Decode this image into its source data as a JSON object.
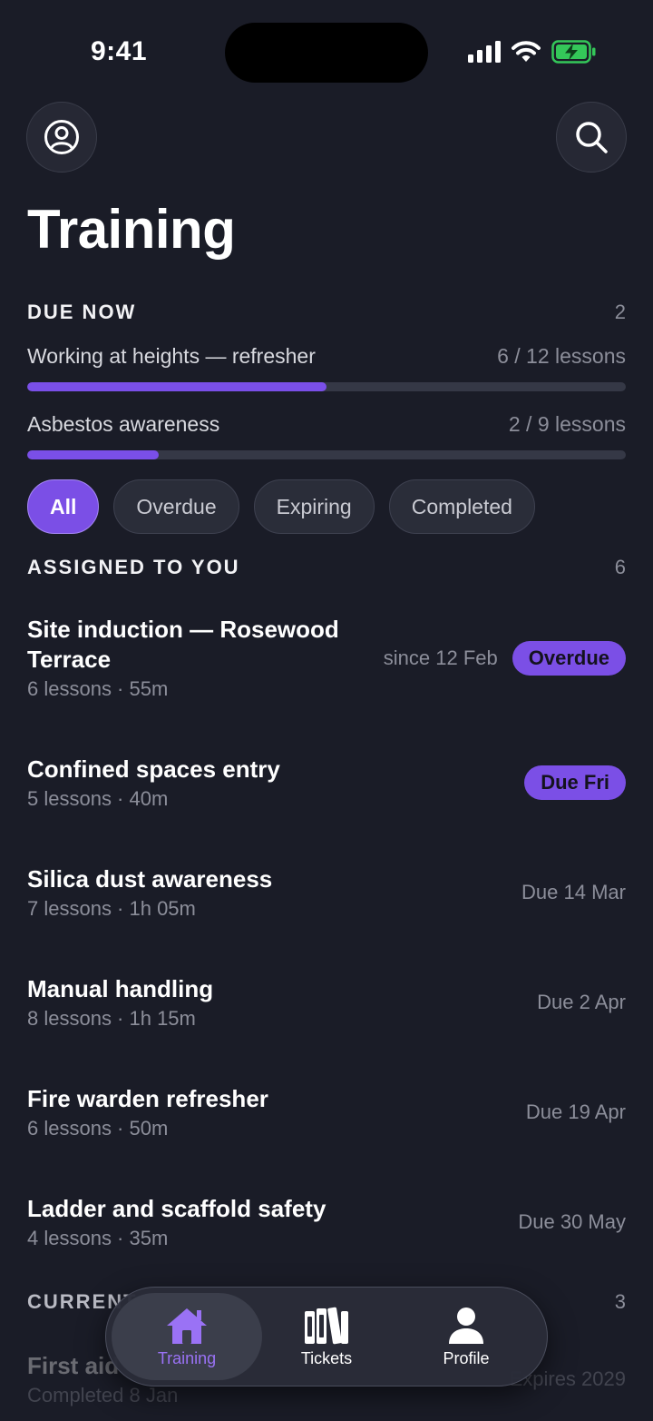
{
  "status_bar": {
    "time": "9:41"
  },
  "header": {
    "title": "Training"
  },
  "due_now": {
    "label": "DUE NOW",
    "count": "2",
    "items": [
      {
        "title": "Working at heights — refresher",
        "progress_text": "6 / 12 lessons",
        "progress": 0.5
      },
      {
        "title": "Asbestos awareness",
        "progress_text": "2 / 9 lessons",
        "progress": 0.22
      }
    ]
  },
  "filters": [
    {
      "label": "All",
      "active": true
    },
    {
      "label": "Overdue",
      "active": false
    },
    {
      "label": "Expiring",
      "active": false
    },
    {
      "label": "Completed",
      "active": false
    }
  ],
  "assigned": {
    "label": "ASSIGNED TO YOU",
    "count": "6",
    "items": [
      {
        "title_line1": "Site induction — Rosewood",
        "title_line2": "Terrace",
        "meta": "6 lessons · 55m",
        "date": "since 12 Feb",
        "badge": "Overdue"
      },
      {
        "title": "Confined spaces entry",
        "meta": "5 lessons · 40m",
        "badge": "Due Fri"
      },
      {
        "title": "Silica dust awareness",
        "meta": "7 lessons · 1h 05m",
        "date": "Due 14 Mar"
      },
      {
        "title": "Manual handling",
        "meta": "8 lessons · 1h 15m",
        "date": "Due 2 Apr"
      },
      {
        "title": "Fire warden refresher",
        "meta": "6 lessons · 50m",
        "date": "Due 19 Apr"
      },
      {
        "title": "Ladder and scaffold safety",
        "meta": "4 lessons · 35m",
        "date": "Due 30 May"
      }
    ]
  },
  "current": {
    "label": "CURRENT",
    "count": "3",
    "first_item": {
      "title": "First aid",
      "meta": "Completed 8 Jan",
      "date": "Expires 2029"
    }
  },
  "tabbar": {
    "tabs": [
      {
        "label": "Training",
        "icon": "house-icon",
        "active": true
      },
      {
        "label": "Tickets",
        "icon": "books-icon",
        "active": false
      },
      {
        "label": "Profile",
        "icon": "person-icon",
        "active": false
      }
    ]
  },
  "colors": {
    "accent": "#7b4fe6",
    "background": "#1a1c27",
    "battery": "#34c759"
  }
}
